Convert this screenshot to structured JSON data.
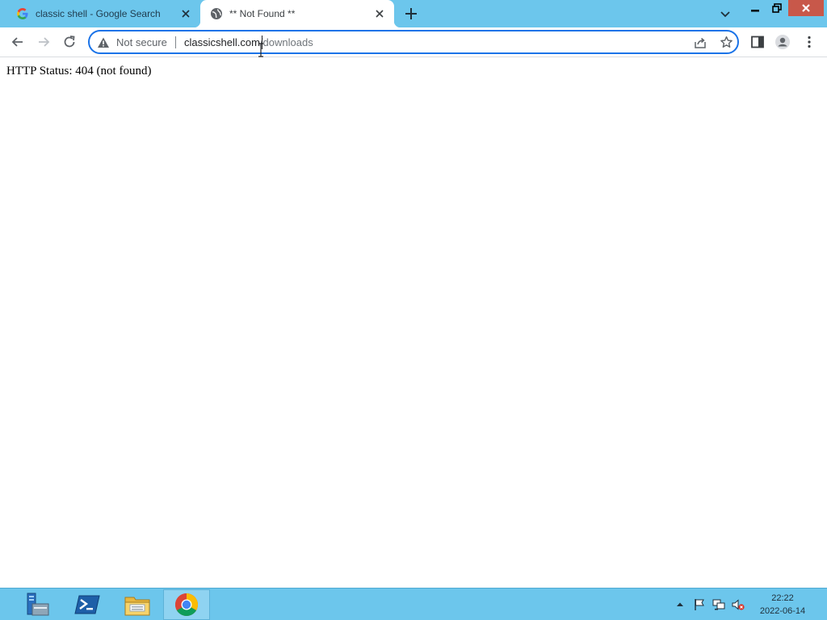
{
  "browser": {
    "tabs": [
      {
        "title": "classic shell - Google Search",
        "active": false,
        "favicon": "google-g-icon"
      },
      {
        "title": "** Not Found **",
        "active": true,
        "favicon": "globe-icon"
      }
    ],
    "address_bar": {
      "security_label": "Not secure",
      "url_host": "classicshell.com",
      "url_path": "/downloads"
    }
  },
  "page": {
    "status_text": "HTTP Status: 404 (not found)"
  },
  "taskbar": {
    "items": [
      "server-manager-icon",
      "powershell-icon",
      "file-explorer-icon",
      "chrome-icon"
    ],
    "clock": {
      "time": "22:22",
      "date": "2022-06-14"
    }
  },
  "colors": {
    "chrome_frame": "#6cc6ec",
    "focus_ring": "#1a73e8",
    "close_button": "#c8584a"
  }
}
